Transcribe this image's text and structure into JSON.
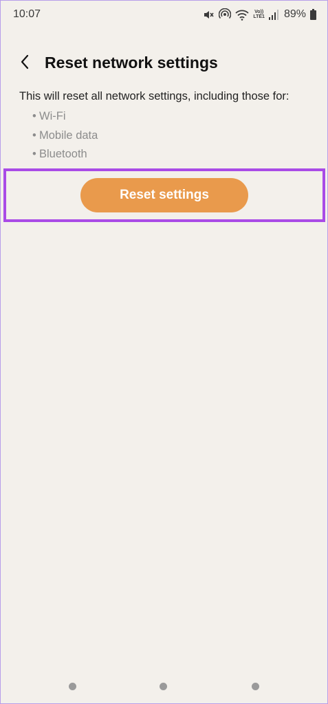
{
  "status_bar": {
    "time": "10:07",
    "volte_top": "Vo))",
    "volte_bottom": "LTE1",
    "battery_percent": "89%",
    "icons": [
      "mute-icon",
      "hotspot-icon",
      "wifi-icon",
      "volte-lte-icon",
      "signal-icon",
      "battery-icon"
    ]
  },
  "header": {
    "back_icon": "chevron-left-icon",
    "title": "Reset network settings"
  },
  "content": {
    "description": "This will reset all network settings, including those for:",
    "items": [
      "Wi-Fi",
      "Mobile data",
      "Bluetooth"
    ],
    "bullet": "•"
  },
  "action": {
    "reset_label": "Reset settings",
    "button_color": "#e99a4c",
    "highlight_color": "#a94be6"
  },
  "nav_bar": {
    "buttons": [
      "recents",
      "home",
      "back"
    ]
  },
  "colors": {
    "background": "#f3f0eb",
    "frame": "#b79ee9"
  }
}
